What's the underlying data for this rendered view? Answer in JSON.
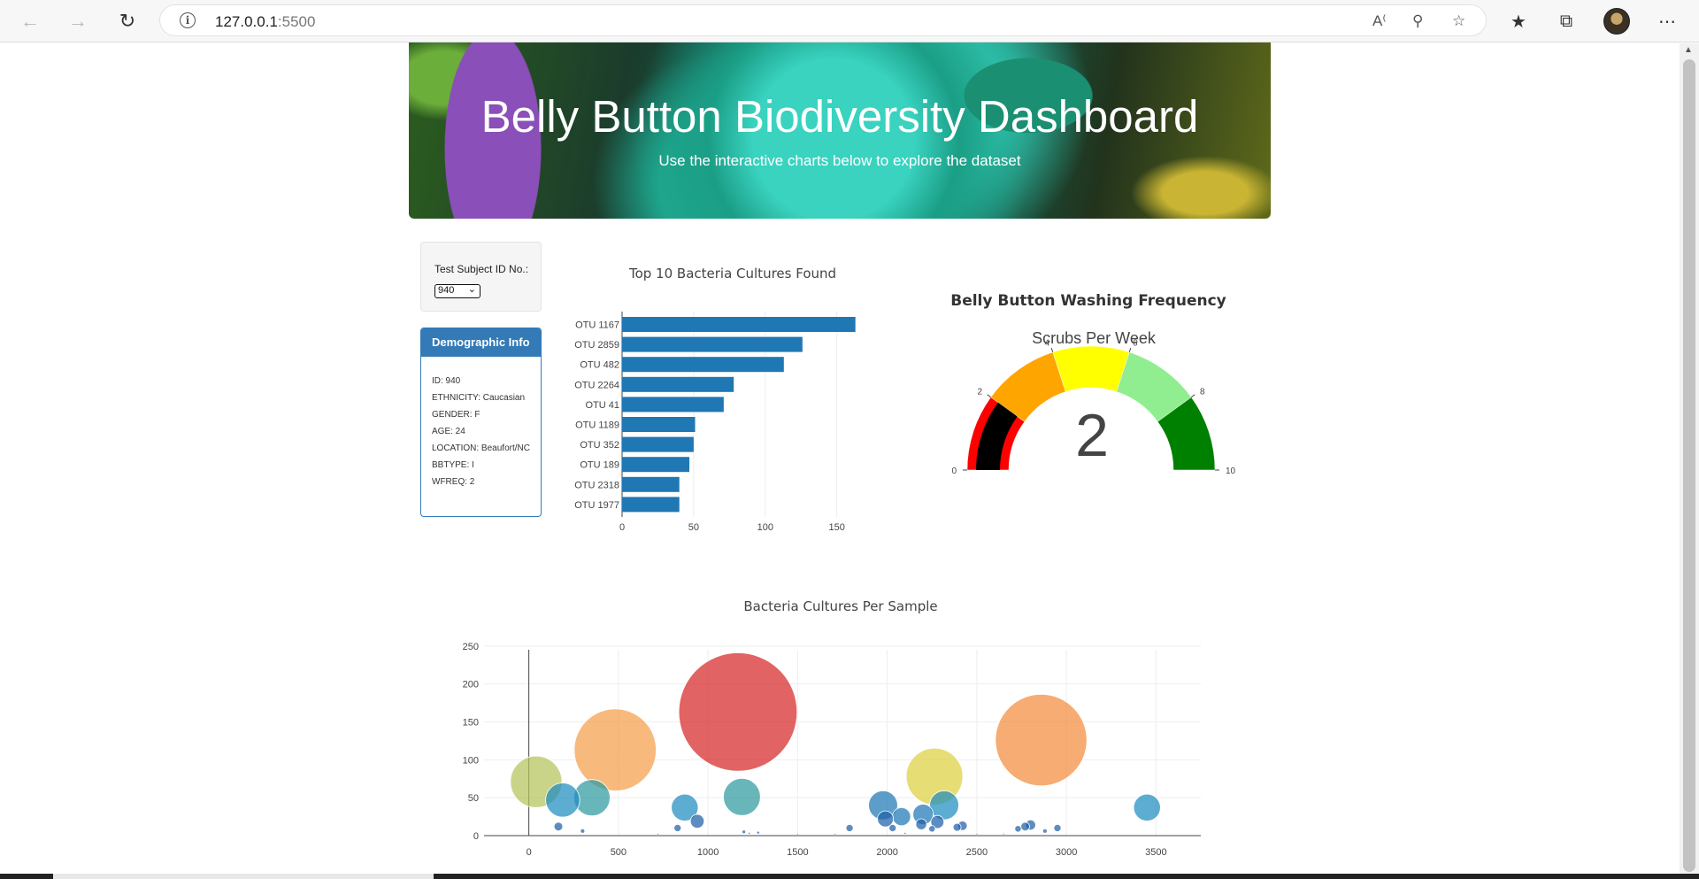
{
  "browser": {
    "url_host": "127.0.0.1",
    "url_port": ":5500",
    "back_icon": "arrow-left-icon",
    "forward_icon": "arrow-right-icon",
    "refresh_icon": "refresh-icon"
  },
  "header": {
    "title": "Belly Button Biodiversity Dashboard",
    "subtitle": "Use the interactive charts below to explore the dataset"
  },
  "selector": {
    "label": "Test Subject ID No.:",
    "selected": "940"
  },
  "demographics": {
    "heading": "Demographic Info",
    "rows": [
      "ID: 940",
      "ETHNICITY: Caucasian",
      "GENDER: F",
      "AGE: 24",
      "LOCATION: Beaufort/NC",
      "BBTYPE: I",
      "WFREQ: 2"
    ]
  },
  "chart_data": [
    {
      "type": "bar",
      "orientation": "horizontal",
      "title": "Top 10 Bacteria Cultures Found",
      "categories": [
        "OTU 1167",
        "OTU 2859",
        "OTU 482",
        "OTU 2264",
        "OTU 41",
        "OTU 1189",
        "OTU 352",
        "OTU 189",
        "OTU 2318",
        "OTU 1977"
      ],
      "values": [
        163,
        126,
        113,
        78,
        71,
        51,
        50,
        47,
        40,
        40
      ],
      "xticks": [
        0,
        50,
        100,
        150
      ],
      "xlim": [
        0,
        170
      ],
      "color": "#1f77b4"
    },
    {
      "type": "gauge",
      "title": "Belly Button Washing Frequency",
      "subtitle": "Scrubs Per Week",
      "value": 2,
      "range": [
        0,
        10
      ],
      "ticks": [
        0,
        2,
        4,
        6,
        8,
        10
      ],
      "steps": [
        {
          "range": [
            0,
            2
          ],
          "color": "#ff0000"
        },
        {
          "range": [
            2,
            4
          ],
          "color": "#ffa500"
        },
        {
          "range": [
            4,
            6
          ],
          "color": "#ffff00"
        },
        {
          "range": [
            6,
            8
          ],
          "color": "#90ee90"
        },
        {
          "range": [
            8,
            10
          ],
          "color": "#008000"
        }
      ],
      "bar_color": "#000000"
    },
    {
      "type": "scatter",
      "title": "Bacteria Cultures Per Sample",
      "xticks": [
        0,
        500,
        1000,
        1500,
        2000,
        2500,
        3000,
        3500
      ],
      "yticks": [
        0,
        50,
        100,
        150,
        200,
        250
      ],
      "xlim": [
        -250,
        3750
      ],
      "ylim": [
        0,
        300
      ],
      "grid": true,
      "points": [
        {
          "x": 1167,
          "y": 163,
          "color": "#d62728"
        },
        {
          "x": 2859,
          "y": 126,
          "color": "#f28c3c"
        },
        {
          "x": 482,
          "y": 113,
          "color": "#f5a04a"
        },
        {
          "x": 2264,
          "y": 78,
          "color": "#dcd040"
        },
        {
          "x": 41,
          "y": 71,
          "color": "#b5c35a"
        },
        {
          "x": 1189,
          "y": 51,
          "color": "#2e9aa0"
        },
        {
          "x": 352,
          "y": 50,
          "color": "#2e9aa0"
        },
        {
          "x": 189,
          "y": 47,
          "color": "#1f8cbf"
        },
        {
          "x": 2318,
          "y": 40,
          "color": "#1f8cbf"
        },
        {
          "x": 1977,
          "y": 40,
          "color": "#1f77b4"
        },
        {
          "x": 3450,
          "y": 37,
          "color": "#1f8cbf"
        },
        {
          "x": 870,
          "y": 37,
          "color": "#1f8cbf"
        },
        {
          "x": 2200,
          "y": 28,
          "color": "#1f77b4"
        },
        {
          "x": 2080,
          "y": 25,
          "color": "#1f77b4"
        },
        {
          "x": 1990,
          "y": 22,
          "color": "#1f5fa8"
        },
        {
          "x": 940,
          "y": 19,
          "color": "#1f5fa8"
        },
        {
          "x": 2280,
          "y": 18,
          "color": "#1f5fa8"
        },
        {
          "x": 2190,
          "y": 15,
          "color": "#1f5fa8"
        },
        {
          "x": 2420,
          "y": 13,
          "color": "#1f5fa8"
        },
        {
          "x": 2390,
          "y": 11,
          "color": "#1f5fa8"
        },
        {
          "x": 2770,
          "y": 12,
          "color": "#1f5fa8"
        },
        {
          "x": 2800,
          "y": 14,
          "color": "#1f5fa8"
        },
        {
          "x": 2950,
          "y": 10,
          "color": "#1f5fa8"
        },
        {
          "x": 2030,
          "y": 10,
          "color": "#1f5fa8"
        },
        {
          "x": 2250,
          "y": 9,
          "color": "#1f5fa8"
        },
        {
          "x": 1790,
          "y": 10,
          "color": "#1f5fa8"
        },
        {
          "x": 165,
          "y": 12,
          "color": "#1f5fa8"
        },
        {
          "x": 830,
          "y": 10,
          "color": "#1f5fa8"
        },
        {
          "x": 2730,
          "y": 9,
          "color": "#1f5fa8"
        },
        {
          "x": 300,
          "y": 6,
          "color": "#1f5fa8"
        },
        {
          "x": 2880,
          "y": 6,
          "color": "#1f5fa8"
        },
        {
          "x": 1200,
          "y": 5,
          "color": "#1f5fa8"
        },
        {
          "x": 1280,
          "y": 4,
          "color": "#1f5fa8"
        },
        {
          "x": 1230,
          "y": 3,
          "color": "#1f5fa8"
        },
        {
          "x": 2100,
          "y": 3,
          "color": "#1f5fa8"
        },
        {
          "x": 2500,
          "y": 2,
          "color": "#1f5fa8"
        },
        {
          "x": 1500,
          "y": 2,
          "color": "#1f5fa8"
        },
        {
          "x": 1710,
          "y": 2,
          "color": "#1f5fa8"
        },
        {
          "x": 2650,
          "y": 2,
          "color": "#1f5fa8"
        },
        {
          "x": 720,
          "y": 2,
          "color": "#1f5fa8"
        }
      ]
    }
  ]
}
